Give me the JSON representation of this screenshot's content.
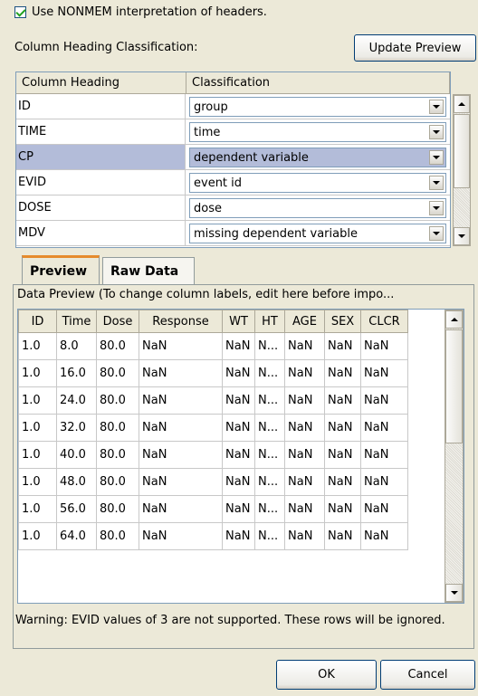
{
  "options": {
    "use_nonmem_label": "Use NONMEM interpretation of headers.",
    "use_nonmem_checked": true
  },
  "classification": {
    "label": "Column Heading Classification:",
    "update_preview_label": "Update Preview",
    "headers": [
      "Column Heading",
      "Classification"
    ],
    "rows": [
      {
        "heading": "ID",
        "classification": "group"
      },
      {
        "heading": "TIME",
        "classification": "time"
      },
      {
        "heading": "CP",
        "classification": "dependent variable",
        "selected": true
      },
      {
        "heading": "EVID",
        "classification": "event id"
      },
      {
        "heading": "DOSE",
        "classification": "dose"
      },
      {
        "heading": "MDV",
        "classification": "missing dependent variable"
      }
    ]
  },
  "tabs": [
    {
      "label": "Preview",
      "active": true
    },
    {
      "label": "Raw Data",
      "active": false
    }
  ],
  "preview": {
    "label": "Data Preview (To change column labels, edit here before impo...",
    "columns": [
      "ID",
      "Time",
      "Dose",
      "Response",
      "WT",
      "HT",
      "AGE",
      "SEX",
      "CLCR"
    ],
    "rows": [
      [
        "1.0",
        "8.0",
        "80.0",
        "NaN",
        "NaN",
        "N...",
        "NaN",
        "NaN",
        "NaN"
      ],
      [
        "1.0",
        "16.0",
        "80.0",
        "NaN",
        "NaN",
        "N...",
        "NaN",
        "NaN",
        "NaN"
      ],
      [
        "1.0",
        "24.0",
        "80.0",
        "NaN",
        "NaN",
        "N...",
        "NaN",
        "NaN",
        "NaN"
      ],
      [
        "1.0",
        "32.0",
        "80.0",
        "NaN",
        "NaN",
        "N...",
        "NaN",
        "NaN",
        "NaN"
      ],
      [
        "1.0",
        "40.0",
        "80.0",
        "NaN",
        "NaN",
        "N...",
        "NaN",
        "NaN",
        "NaN"
      ],
      [
        "1.0",
        "48.0",
        "80.0",
        "NaN",
        "NaN",
        "N...",
        "NaN",
        "NaN",
        "NaN"
      ],
      [
        "1.0",
        "56.0",
        "80.0",
        "NaN",
        "NaN",
        "N...",
        "NaN",
        "NaN",
        "NaN"
      ],
      [
        "1.0",
        "64.0",
        "80.0",
        "NaN",
        "NaN",
        "N...",
        "NaN",
        "NaN",
        "NaN"
      ]
    ]
  },
  "warning": "Warning: EVID values of 3 are not supported. These rows will be ignored.",
  "footer": {
    "ok_label": "OK",
    "cancel_label": "Cancel"
  },
  "colors": {
    "dialog_bg": "#ece9d8",
    "selection": "#b3bcd9",
    "active_tab_accent": "#e68b2c",
    "border": "#7f9db9"
  }
}
